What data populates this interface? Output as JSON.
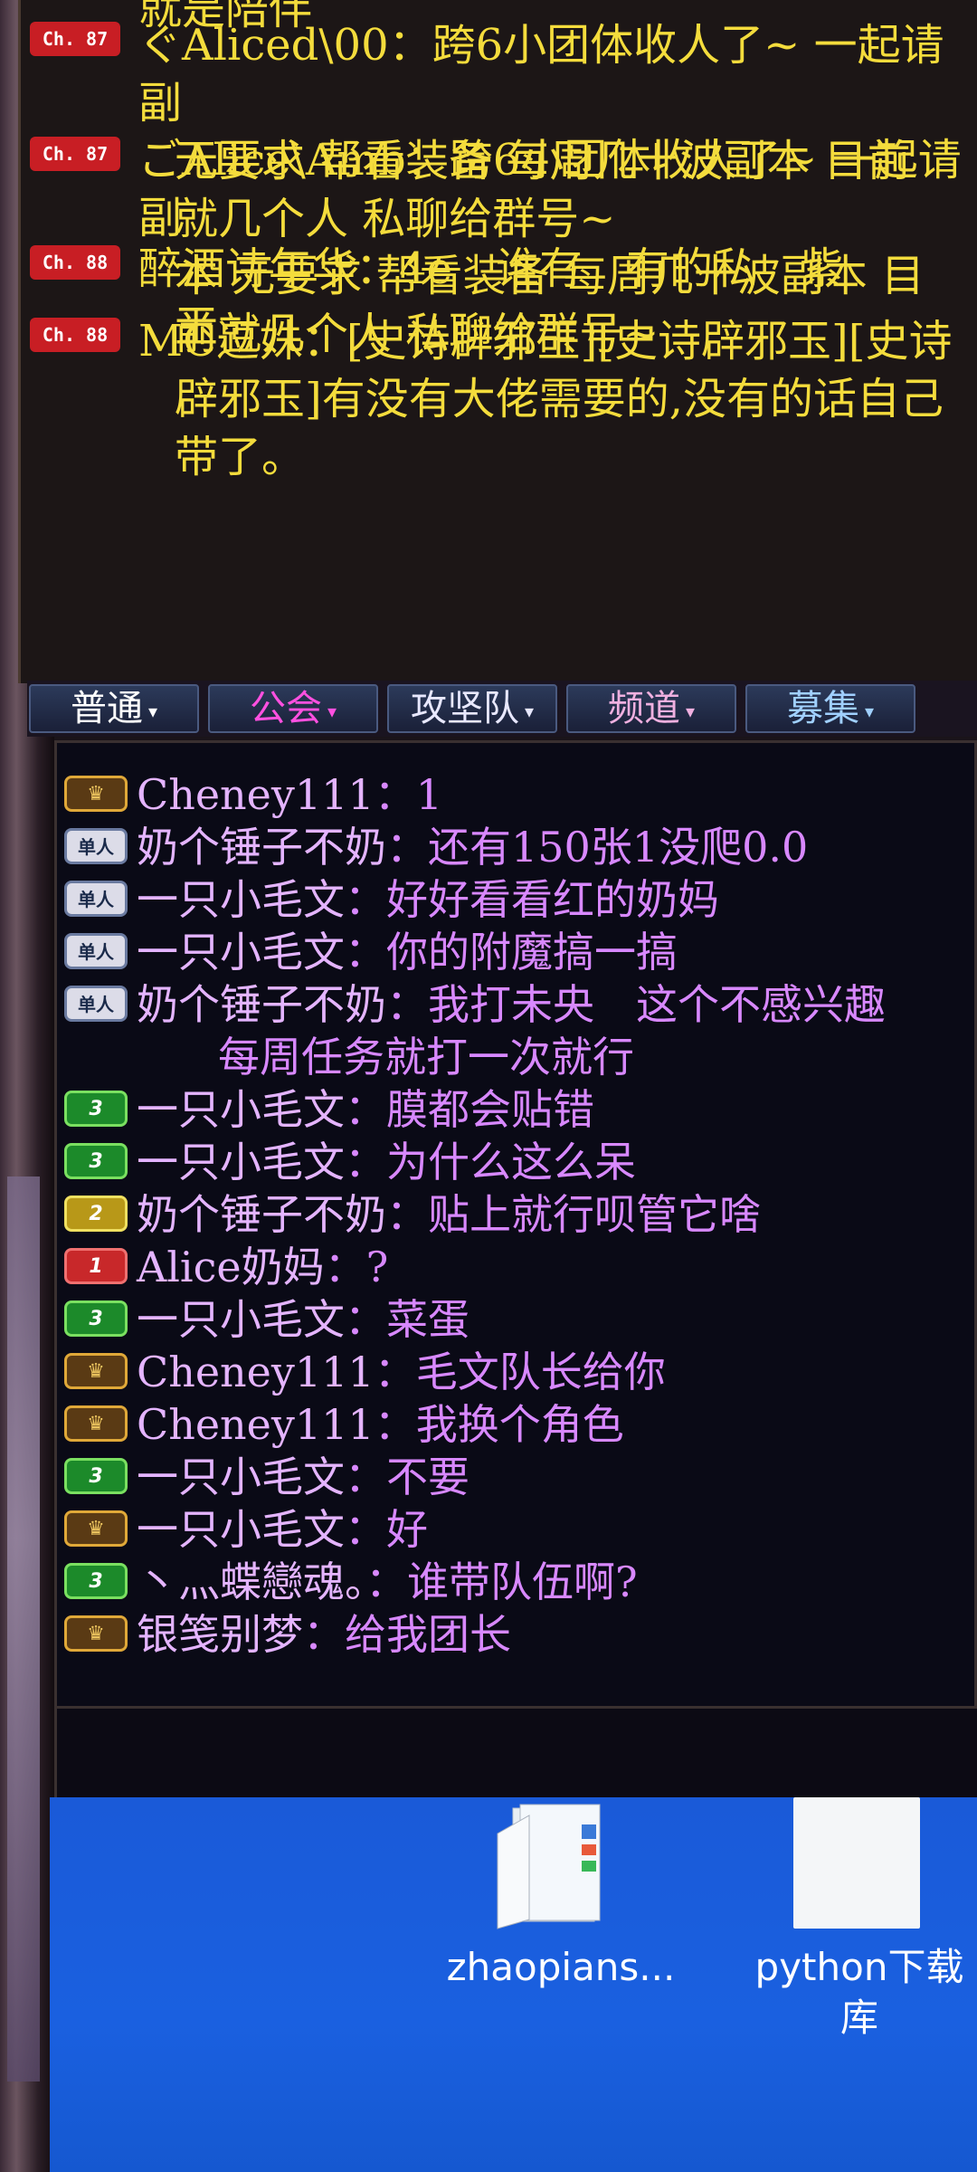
{
  "channel_messages": [
    {
      "badge": "",
      "text": "就是陪伴"
    },
    {
      "badge": "Ch. 87",
      "text": "ぐAliced\\00：跨6小团体收人了~ 一起请副",
      "cont": [
        "无要求 帮看装备 每周几十波副本 目前",
        "就几个人 私聊给群号~"
      ]
    },
    {
      "badge": "Ch. 87",
      "text": "ごAlice\\Amb：跨6小团体收人了~ 一起请副",
      "cont": [
        "本 无要求 帮看装备 每周几十波副本 目",
        "前就几个人 私聊给群号~"
      ]
    },
    {
      "badge": "Ch. 88",
      "text": "醉酒诗年华：4e　谁有　有的私　紫",
      "cont": [
        "玉"
      ]
    },
    {
      "badge": "Ch. 88",
      "text": "MC逗姝：[史诗辟邪玉][史诗辟邪玉][史诗",
      "cont": [
        "辟邪玉]有没有大佬需要的,没有的话自己",
        "带了。"
      ]
    }
  ],
  "tabs": [
    {
      "label": "普通",
      "color": "#ffffff"
    },
    {
      "label": "公会",
      "color": "#ff50e0"
    },
    {
      "label": "攻坚队",
      "color": "#e8e8ff"
    },
    {
      "label": "频道",
      "color": "#f0b0e0"
    },
    {
      "label": "募集",
      "color": "#a0d0ff"
    }
  ],
  "tab_arrow": "▾",
  "chat_messages": [
    {
      "icon": "crown",
      "icon_text": "♛",
      "name": "Cheney111",
      "sep": "：",
      "text": "1"
    },
    {
      "icon": "solo",
      "icon_text": "单人",
      "name": "奶个锤子不奶",
      "sep": "：",
      "text": "还有150张1没爬0.0"
    },
    {
      "icon": "solo",
      "icon_text": "单人",
      "name": "一只小毛文",
      "sep": "：",
      "text": "好好看看红的奶妈"
    },
    {
      "icon": "solo",
      "icon_text": "单人",
      "name": "一只小毛文",
      "sep": "：",
      "text": "你的附魔搞一搞"
    },
    {
      "icon": "solo",
      "icon_text": "单人",
      "name": "奶个锤子不奶",
      "sep": "：",
      "text": "我打未央　这个不感兴趣",
      "cont": "每周任务就打一次就行"
    },
    {
      "icon": "green",
      "icon_text": "3",
      "name": "一只小毛文",
      "sep": "：",
      "text": "膜都会贴错"
    },
    {
      "icon": "green",
      "icon_text": "3",
      "name": "一只小毛文",
      "sep": "：",
      "text": "为什么这么呆"
    },
    {
      "icon": "yellow",
      "icon_text": "2",
      "name": "奶个锤子不奶",
      "sep": "：",
      "text": "贴上就行呗管它啥"
    },
    {
      "icon": "red",
      "icon_text": "1",
      "name": "Alice奶妈",
      "sep": "：",
      "text": "?"
    },
    {
      "icon": "green",
      "icon_text": "3",
      "name": "一只小毛文",
      "sep": "：",
      "text": "菜蛋"
    },
    {
      "icon": "crown",
      "icon_text": "♛",
      "name": "Cheney111",
      "sep": "：",
      "text": "毛文队长给你"
    },
    {
      "icon": "crown",
      "icon_text": "♛",
      "name": "Cheney111",
      "sep": "：",
      "text": "我换个角色"
    },
    {
      "icon": "green",
      "icon_text": "3",
      "name": "一只小毛文",
      "sep": "：",
      "text": "不要"
    },
    {
      "icon": "crown",
      "icon_text": "♛",
      "name": "一只小毛文",
      "sep": "：",
      "text": "好"
    },
    {
      "icon": "green",
      "icon_text": "3",
      "name": "丶灬蝶戀魂。",
      "sep": "：",
      "text": "谁带队伍啊?"
    },
    {
      "icon": "crown",
      "icon_text": "♛",
      "name": "银笺别梦",
      "sep": "：",
      "text": "给我团长"
    }
  ],
  "desktop": {
    "folder_label": "zhaopians...",
    "file_label_1": "python下载",
    "file_label_2": "库"
  }
}
